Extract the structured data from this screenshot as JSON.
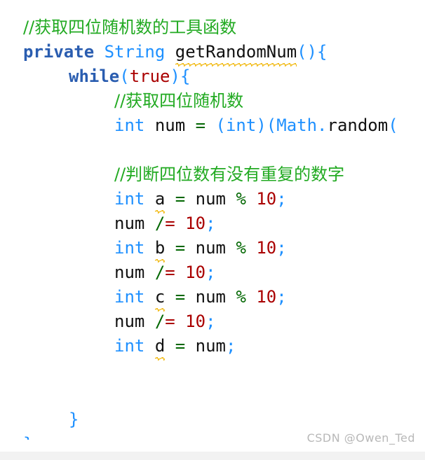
{
  "watermark": {
    "text": "CSDN @Owen_Ted"
  },
  "colors": {
    "background": "#ffffff",
    "comment": "#22aa22",
    "keyword": "#2a5db0",
    "type": "#1e90ff",
    "identifier": "#111111",
    "punctuation": "#1e90ff",
    "literal": "#aa0000",
    "operator": "#006600",
    "warning_squiggle": "#f0b400",
    "watermark": "#b8b8b8",
    "bottom_strip": "#f2f2f2"
  },
  "code": {
    "language": "java",
    "lines": [
      {
        "indent": 0,
        "tokens": [
          {
            "t": "//获取四位随机数的工具函数",
            "k": "comment"
          }
        ]
      },
      {
        "indent": 0,
        "tokens": [
          {
            "t": "private",
            "k": "keyword"
          },
          {
            "t": " ",
            "k": "plain"
          },
          {
            "t": "String",
            "k": "type"
          },
          {
            "t": " ",
            "k": "plain"
          },
          {
            "t": "getRandomNum",
            "k": "warn"
          },
          {
            "t": "(){",
            "k": "punct"
          }
        ]
      },
      {
        "indent": 1,
        "tokens": [
          {
            "t": "while",
            "k": "keyword"
          },
          {
            "t": "(",
            "k": "punct"
          },
          {
            "t": "true",
            "k": "literal"
          },
          {
            "t": "){",
            "k": "punct"
          }
        ]
      },
      {
        "indent": 2,
        "tokens": [
          {
            "t": "//获取四位随机数",
            "k": "comment"
          }
        ]
      },
      {
        "indent": 2,
        "tokens": [
          {
            "t": "int",
            "k": "type"
          },
          {
            "t": " ",
            "k": "plain"
          },
          {
            "t": "num",
            "k": "ident"
          },
          {
            "t": " ",
            "k": "plain"
          },
          {
            "t": "=",
            "k": "operator"
          },
          {
            "t": " ",
            "k": "plain"
          },
          {
            "t": "(",
            "k": "punct"
          },
          {
            "t": "int",
            "k": "type"
          },
          {
            "t": ")(",
            "k": "punct"
          },
          {
            "t": "Math",
            "k": "type"
          },
          {
            "t": ".",
            "k": "punct"
          },
          {
            "t": "random",
            "k": "ident"
          },
          {
            "t": "(",
            "k": "punct"
          }
        ]
      },
      {
        "indent": 2,
        "tokens": []
      },
      {
        "indent": 2,
        "tokens": [
          {
            "t": "//判断四位数有没有重复的数字",
            "k": "comment"
          }
        ]
      },
      {
        "indent": 2,
        "tokens": [
          {
            "t": "int",
            "k": "type"
          },
          {
            "t": " ",
            "k": "plain"
          },
          {
            "t": "a",
            "k": "warn"
          },
          {
            "t": " ",
            "k": "plain"
          },
          {
            "t": "=",
            "k": "operator"
          },
          {
            "t": " ",
            "k": "plain"
          },
          {
            "t": "num",
            "k": "ident"
          },
          {
            "t": " ",
            "k": "plain"
          },
          {
            "t": "%",
            "k": "operator"
          },
          {
            "t": " ",
            "k": "plain"
          },
          {
            "t": "10",
            "k": "literal"
          },
          {
            "t": ";",
            "k": "punct"
          }
        ]
      },
      {
        "indent": 2,
        "tokens": [
          {
            "t": "num",
            "k": "ident"
          },
          {
            "t": " ",
            "k": "plain"
          },
          {
            "t": "/",
            "k": "operator"
          },
          {
            "t": "=",
            "k": "literal"
          },
          {
            "t": " ",
            "k": "plain"
          },
          {
            "t": "10",
            "k": "literal"
          },
          {
            "t": ";",
            "k": "punct"
          }
        ]
      },
      {
        "indent": 2,
        "tokens": [
          {
            "t": "int",
            "k": "type"
          },
          {
            "t": " ",
            "k": "plain"
          },
          {
            "t": "b",
            "k": "warn"
          },
          {
            "t": " ",
            "k": "plain"
          },
          {
            "t": "=",
            "k": "operator"
          },
          {
            "t": " ",
            "k": "plain"
          },
          {
            "t": "num",
            "k": "ident"
          },
          {
            "t": " ",
            "k": "plain"
          },
          {
            "t": "%",
            "k": "operator"
          },
          {
            "t": " ",
            "k": "plain"
          },
          {
            "t": "10",
            "k": "literal"
          },
          {
            "t": ";",
            "k": "punct"
          }
        ]
      },
      {
        "indent": 2,
        "tokens": [
          {
            "t": "num",
            "k": "ident"
          },
          {
            "t": " ",
            "k": "plain"
          },
          {
            "t": "/",
            "k": "operator"
          },
          {
            "t": "=",
            "k": "literal"
          },
          {
            "t": " ",
            "k": "plain"
          },
          {
            "t": "10",
            "k": "literal"
          },
          {
            "t": ";",
            "k": "punct"
          }
        ]
      },
      {
        "indent": 2,
        "tokens": [
          {
            "t": "int",
            "k": "type"
          },
          {
            "t": " ",
            "k": "plain"
          },
          {
            "t": "c",
            "k": "warn"
          },
          {
            "t": " ",
            "k": "plain"
          },
          {
            "t": "=",
            "k": "operator"
          },
          {
            "t": " ",
            "k": "plain"
          },
          {
            "t": "num",
            "k": "ident"
          },
          {
            "t": " ",
            "k": "plain"
          },
          {
            "t": "%",
            "k": "operator"
          },
          {
            "t": " ",
            "k": "plain"
          },
          {
            "t": "10",
            "k": "literal"
          },
          {
            "t": ";",
            "k": "punct"
          }
        ]
      },
      {
        "indent": 2,
        "tokens": [
          {
            "t": "num",
            "k": "ident"
          },
          {
            "t": " ",
            "k": "plain"
          },
          {
            "t": "/",
            "k": "operator"
          },
          {
            "t": "=",
            "k": "literal"
          },
          {
            "t": " ",
            "k": "plain"
          },
          {
            "t": "10",
            "k": "literal"
          },
          {
            "t": ";",
            "k": "punct"
          }
        ]
      },
      {
        "indent": 2,
        "tokens": [
          {
            "t": "int",
            "k": "type"
          },
          {
            "t": " ",
            "k": "plain"
          },
          {
            "t": "d",
            "k": "warn"
          },
          {
            "t": " ",
            "k": "plain"
          },
          {
            "t": "=",
            "k": "operator"
          },
          {
            "t": " ",
            "k": "plain"
          },
          {
            "t": "num",
            "k": "ident"
          },
          {
            "t": ";",
            "k": "punct"
          }
        ]
      },
      {
        "indent": 2,
        "tokens": []
      },
      {
        "indent": 2,
        "tokens": []
      },
      {
        "indent": 1,
        "tokens": [
          {
            "t": "}",
            "k": "punct"
          }
        ]
      },
      {
        "indent": 0,
        "tokens": [
          {
            "t": "}",
            "k": "punct"
          }
        ]
      }
    ]
  }
}
